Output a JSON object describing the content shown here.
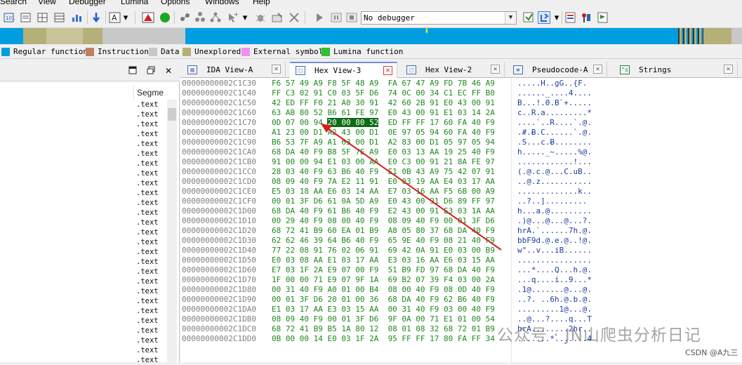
{
  "menu": [
    "Search",
    "View",
    "Debugger",
    "Lumina",
    "Options",
    "Windows",
    "Help"
  ],
  "toolbar": {
    "debugger_select": "No debugger",
    "icons": [
      "run-icon",
      "pause-icon",
      "stop-icon",
      "debugger-select",
      "attach-icon",
      "breakpoint-icon",
      "trace-icon",
      "flag-icon"
    ]
  },
  "legend": [
    {
      "label": "Regular function",
      "color": "#009ee0"
    },
    {
      "label": "Instruction",
      "color": "#c08060"
    },
    {
      "label": "Data",
      "color": "#c8c8c8"
    },
    {
      "label": "Unexplored",
      "color": "#b4b078"
    },
    {
      "label": "External symbol",
      "color": "#f090f0"
    },
    {
      "label": "Lumina function",
      "color": "#30c030"
    }
  ],
  "segments_pane": {
    "column_header": "Segme",
    "entries": [
      ".text",
      ".text",
      ".text",
      ".text",
      ".text",
      ".text",
      ".text",
      ".text",
      ".text",
      ".text",
      ".text",
      ".text",
      ".text",
      ".text",
      ".text",
      ".text",
      ".text",
      ".text",
      ".text",
      ".text",
      ".text",
      ".text",
      ".text",
      ".text",
      ".text",
      ".text",
      ".text"
    ]
  },
  "tabs": [
    {
      "label": "IDA View-A",
      "icon": "ida-view-icon",
      "active": false
    },
    {
      "label": "Hex View-3",
      "icon": "hex-view-icon",
      "active": true
    },
    {
      "label": "Hex View-2",
      "icon": "hex-view-icon",
      "active": false
    },
    {
      "label": "Pseudocode-A",
      "icon": "pseudocode-icon",
      "active": false
    },
    {
      "label": "Strings",
      "icon": "strings-icon",
      "active": false
    }
  ],
  "hex_rows": [
    {
      "addr": "00000000002C1C30",
      "hex": "F6 57 49 A9 F8 5F 48 A9  FA 67 47 A9 FD 7B 46 A9",
      "ascii": ".....H..gG..{F."
    },
    {
      "addr": "00000000002C1C40",
      "hex": "FF C3 02 91 C0 03 5F D6  74 0C 00 34 C1 EC FF B0",
      "ascii": "......_....4...."
    },
    {
      "addr": "00000000002C1C50",
      "hex": "42 ED FF F0 21 A0 30 91  42 60 2B 91 E0 43 00 91",
      "ascii": "B...!.0.B`+....."
    },
    {
      "addr": "00000000002C1C60",
      "hex": "63 AB 80 52 B6 61 FE 97  E0 43 00 91 E1 03 14 2A",
      "ascii": "c..R.a.........*"
    },
    {
      "addr": "00000000002C1C70",
      "hex_pre": "0D 07 00 94 ",
      "hex_hl": "20 00 80 52",
      "hex_post": "  ED FF FF 17 60 FA 40 F9",
      "ascii": "....`..R....`.@."
    },
    {
      "addr": "00000000002C1C80",
      "hex": "A1 23 00 D1 A2 43 00 D1  0E 97 05 94 60 FA 40 F9",
      "ascii": ".#.Ƀ.C......`.@."
    },
    {
      "addr": "00000000002C1C90",
      "hex": "B6 53 7F A9 A1 63 00 D1  A2 83 00 D1 05 97 05 94",
      "ascii": ".S...c.Ƀ........"
    },
    {
      "addr": "00000000002C1CA0",
      "hex": "68 DA 40 F9 B8 5F 7E A9  E0 03 13 AA 19 25 40 F9",
      "ascii": "h....._~.....%@."
    },
    {
      "addr": "00000000002C1CB0",
      "hex": "91 00 00 94 E1 03 00 AA  E0 C3 00 91 21 8A FE 97",
      "ascii": "............!..."
    },
    {
      "addr": "00000000002C1CC0",
      "hex": "28 03 40 F9 63 B6 40 F9  E1 0B 43 A9 75 42 07 91",
      "ascii": "(.@.c.@...C.uB.."
    },
    {
      "addr": "00000000002C1CD0",
      "hex": "08 09 40 F9 7A E2 11 91  E0 03 19 AA E4 03 17 AA",
      "ascii": "..@.z..........."
    },
    {
      "addr": "00000000002C1CE0",
      "hex": "E5 03 18 AA E6 03 14 AA  E7 03 16 AA F5 6B 00 A9",
      "ascii": ".............k.."
    },
    {
      "addr": "00000000002C1CF0",
      "hex": "00 01 3F D6 61 0A 5D A9  E0 43 00 91 D6 89 FF 97",
      "ascii": "..?..]........."
    },
    {
      "addr": "00000000002C1D00",
      "hex": "68 DA 40 F9 61 B6 40 F9  E2 43 00 91 E3 03 1A AA",
      "ascii": "h...a.@........."
    },
    {
      "addr": "00000000002C1D10",
      "hex": "00 29 40 F9 08 00 40 F9  08 09 40 F9 00 01 3F D6",
      "ascii": ".)@...@...@...?."
    },
    {
      "addr": "00000000002C1D20",
      "hex": "68 72 41 B9 60 EA 01 B9  A8 05 80 37 68 DA 40 F9",
      "ascii": "hrA.`......7h.@."
    },
    {
      "addr": "00000000002C1D30",
      "hex": "62 62 46 39 64 B6 40 F9  65 9E 40 F9 08 21 40 F9",
      "ascii": "bbF9d.@.e.@..!@."
    },
    {
      "addr": "00000000002C1D40",
      "hex": "77 22 08 91 76 02 06 91  69 42 0A 91 E0 03 00 B9",
      "ascii": "w\"..v...iB......"
    },
    {
      "addr": "00000000002C1D50",
      "hex": "E0 03 08 AA E1 03 17 AA  E3 03 16 AA E6 03 15 AA",
      "ascii": "................"
    },
    {
      "addr": "00000000002C1D60",
      "hex": "E7 03 1F 2A E9 07 00 F9  51 B9 FD 97 68 DA 40 F9",
      "ascii": "...*....Q...h.@."
    },
    {
      "addr": "00000000002C1D70",
      "hex": "1F 00 00 71 E9 07 9F 1A  69 B2 07 39 F4 03 00 2A",
      "ascii": "...q....i..9...*"
    },
    {
      "addr": "00000000002C1D80",
      "hex": "00 31 40 F9 A0 01 00 B4  08 00 40 F9 08 0D 40 F9",
      "ascii": ".1@.......@...@."
    },
    {
      "addr": "00000000002C1D90",
      "hex": "00 01 3F D6 20 01 00 36  68 DA 40 F9 62 B6 40 F9",
      "ascii": "..?. ..6h.@.b.@."
    },
    {
      "addr": "00000000002C1DA0",
      "hex": "E1 03 17 AA E3 03 15 AA  00 31 40 F9 03 00 40 F9",
      "ascii": ".........1@...@."
    },
    {
      "addr": "00000000002C1DB0",
      "hex": "08 09 40 F9 00 01 3F D6  9F 0A 00 71 E1 01 00 54",
      "ascii": "..@...?....q...T"
    },
    {
      "addr": "00000000002C1DC0",
      "hex": "68 72 41 B9 B5 1A 80 12  08 01 08 32 68 72 01 B9",
      "ascii": "hrA........2hr.."
    },
    {
      "addr": "00000000002C1DD0",
      "hex": "0B 00 00 14 E0 03 1F 2A  95 FF FF 17 80 FA FF 34",
      "ascii": ".......*.......4"
    }
  ],
  "watermark": "公众号 · JN山爬虫分析日记",
  "csdn": "CSDN @A九三"
}
